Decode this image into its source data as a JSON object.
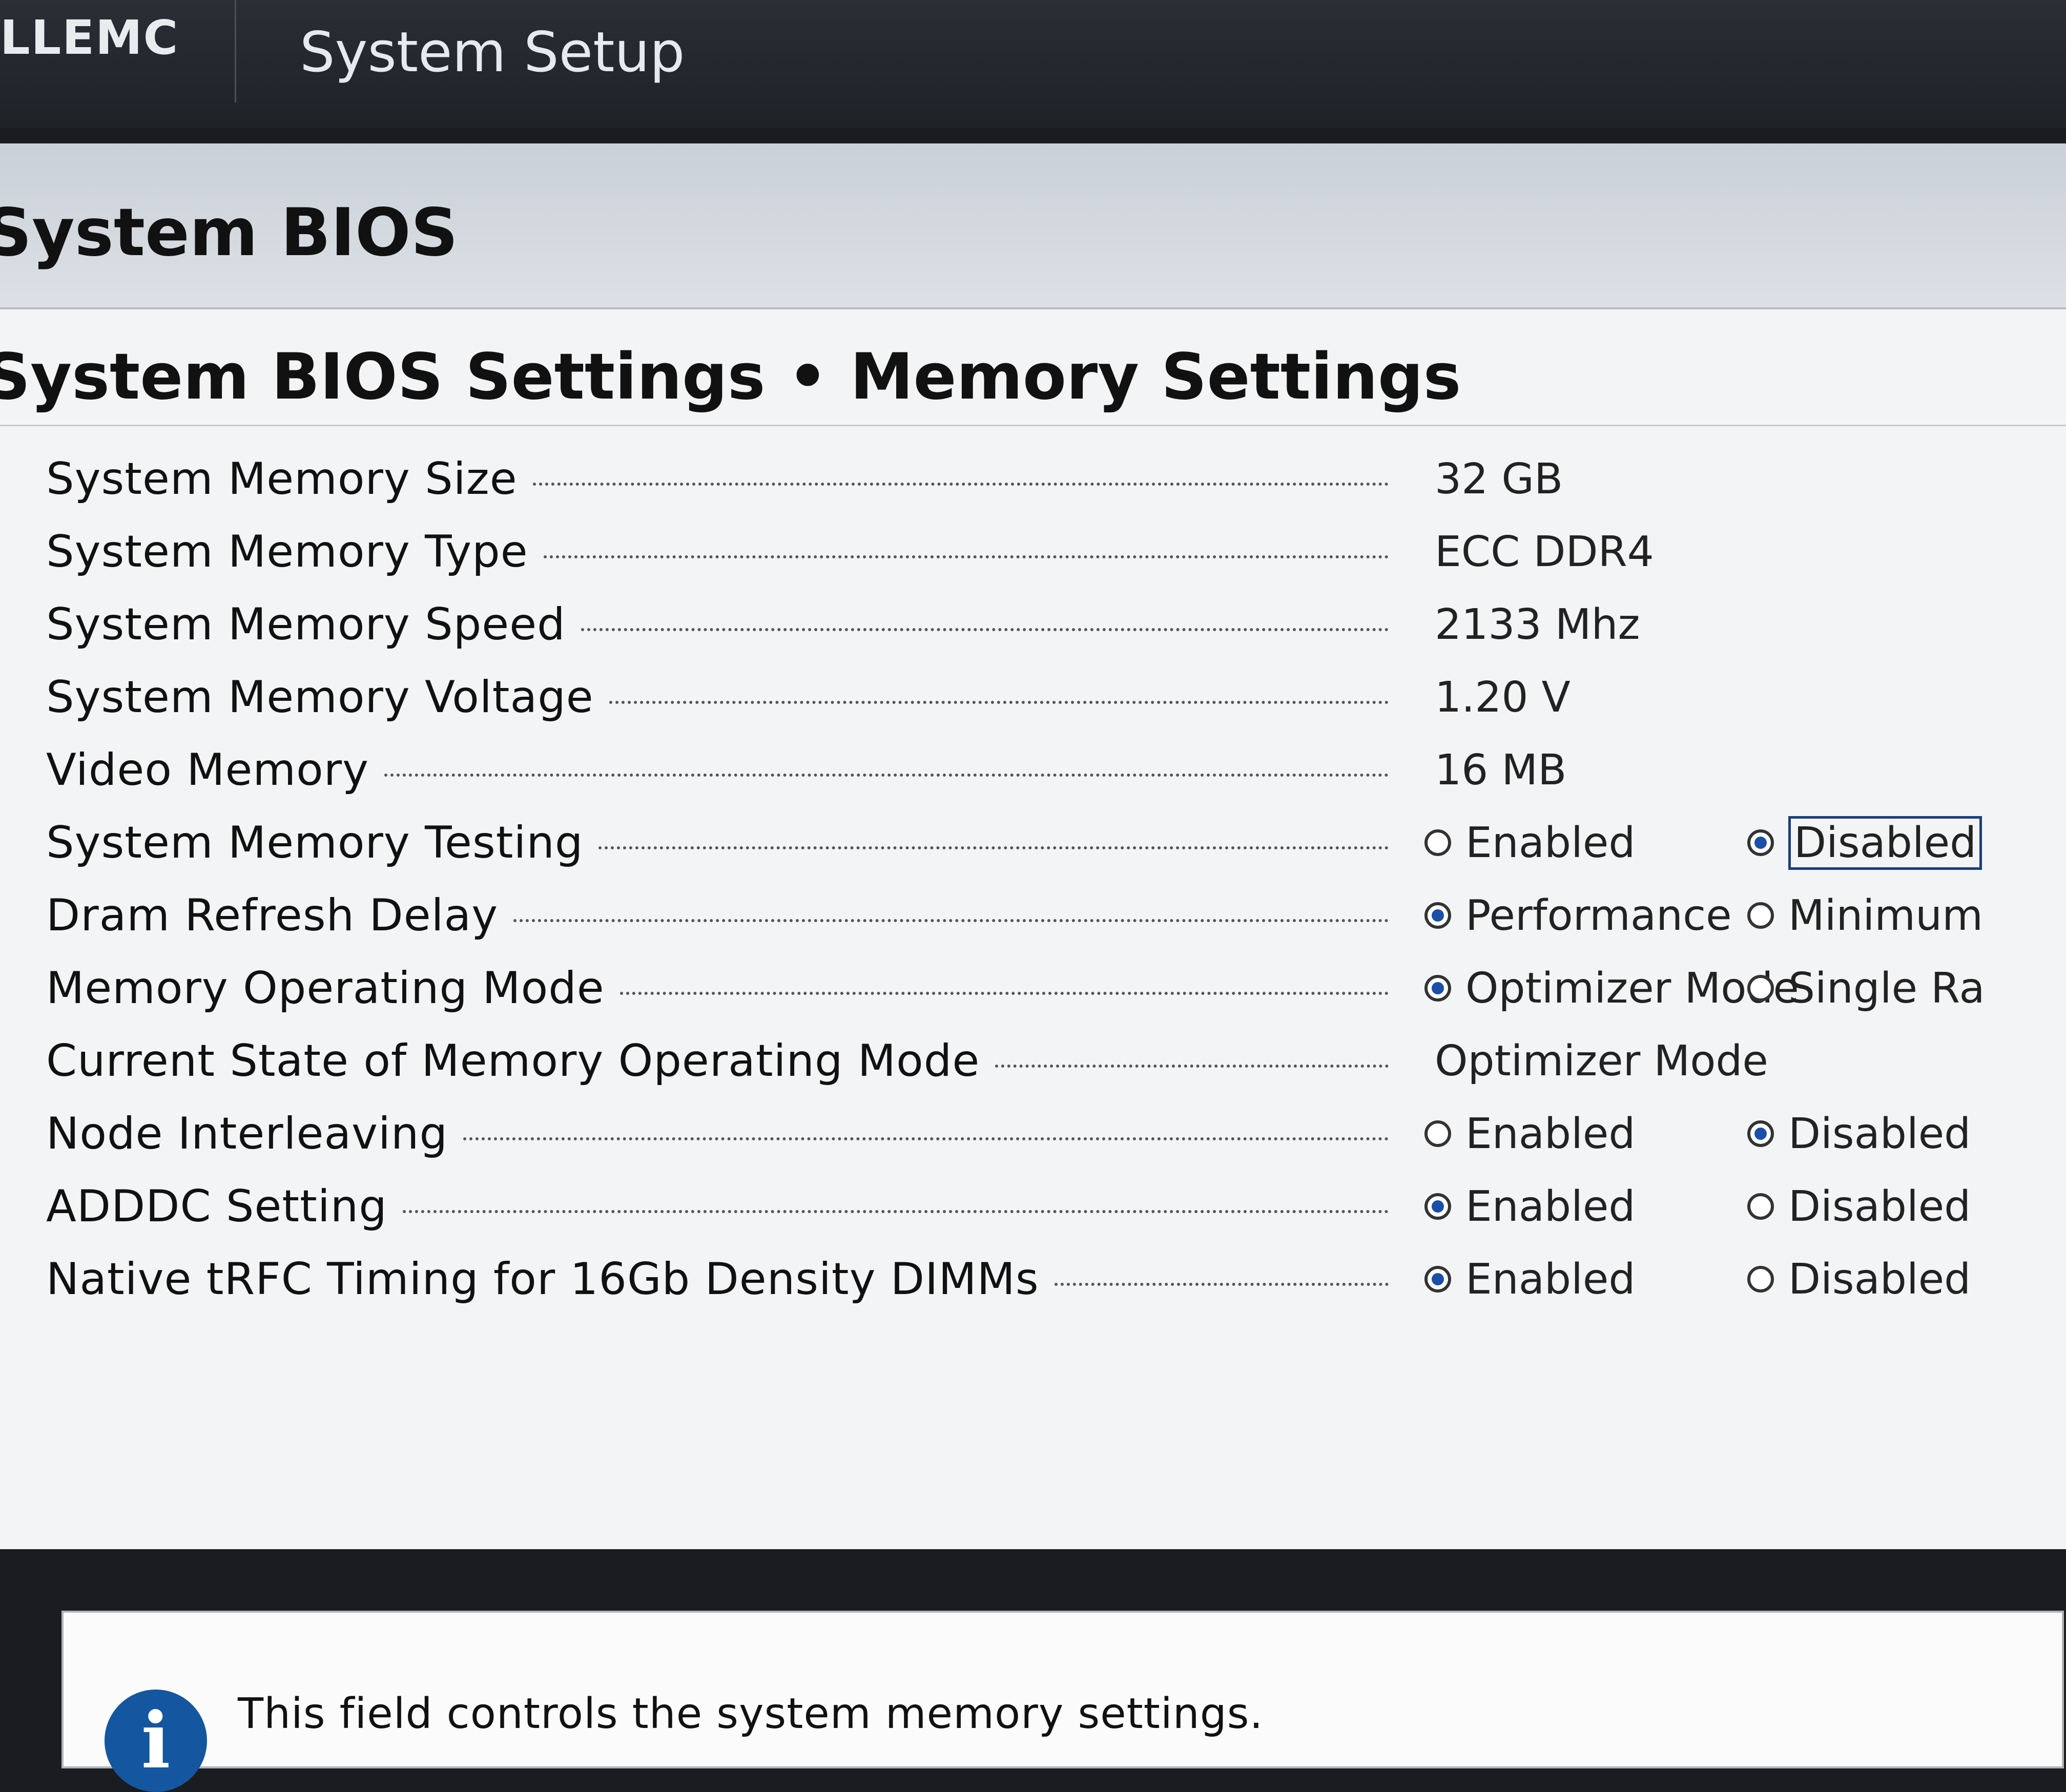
{
  "header": {
    "brand": "LLEMC",
    "app_title": "System Setup"
  },
  "page": {
    "title": "System BIOS",
    "section_title": "System BIOS Settings • Memory Settings"
  },
  "rows": [
    {
      "label": "System Memory Size",
      "value": "32 GB"
    },
    {
      "label": "System Memory Type",
      "value": "ECC DDR4"
    },
    {
      "label": "System Memory Speed",
      "value": "2133 Mhz"
    },
    {
      "label": "System Memory Voltage",
      "value": "1.20 V"
    },
    {
      "label": "Video Memory",
      "value": "16 MB"
    },
    {
      "label": "System Memory Testing",
      "options": [
        "Enabled",
        "Disabled"
      ],
      "selected": "Disabled"
    },
    {
      "label": "Dram Refresh Delay",
      "options": [
        "Performance",
        "Minimum"
      ],
      "selected": "Performance"
    },
    {
      "label": "Memory Operating Mode",
      "options": [
        "Optimizer Mode",
        "Single Ra"
      ],
      "selected": "Optimizer Mode"
    },
    {
      "label": "Current State of Memory Operating Mode",
      "value": "Optimizer Mode"
    },
    {
      "label": "Node Interleaving",
      "options": [
        "Enabled",
        "Disabled"
      ],
      "selected": "Disabled"
    },
    {
      "label": "ADDDC Setting",
      "options": [
        "Enabled",
        "Disabled"
      ],
      "selected": "Enabled"
    },
    {
      "label": "Native tRFC Timing for 16Gb Density DIMMs",
      "options": [
        "Enabled",
        "Disabled"
      ],
      "selected": "Enabled"
    }
  ],
  "info": {
    "icon": "info-icon",
    "icon_glyph": "i",
    "text": "This field controls the system memory settings."
  },
  "colors": {
    "topbar": "#1f2227",
    "radio_selected": "#1b4fa8",
    "info_icon": "#14569f"
  }
}
